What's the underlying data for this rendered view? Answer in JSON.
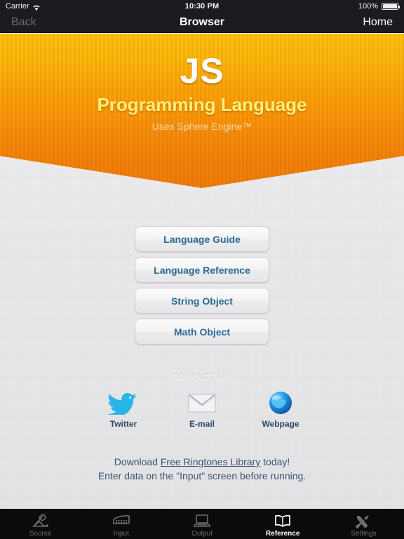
{
  "status_bar": {
    "carrier": "Carrier",
    "wifi_icon": "wifi-icon",
    "time": "10:30 PM",
    "battery_percent": "100%",
    "battery_icon": "battery-icon"
  },
  "nav_bar": {
    "back_label": "Back",
    "title": "Browser",
    "home_label": "Home"
  },
  "banner": {
    "logo": "JS",
    "subtitle": "Programming Language",
    "engine_note": "Uses Sphere Engine™",
    "colors": {
      "top": "#fec10d",
      "bottom": "#f07c08",
      "subtitle_color": "#ffef7a"
    }
  },
  "menu": {
    "buttons": [
      {
        "label": "Language Guide"
      },
      {
        "label": "Language Reference"
      },
      {
        "label": "String Object"
      },
      {
        "label": "Math Object"
      }
    ],
    "text_color": "#2c6b92"
  },
  "contact": {
    "title": "CONTACT US:",
    "items": [
      {
        "label": "Twitter",
        "icon": "twitter-bird-icon"
      },
      {
        "label": "E-mail",
        "icon": "envelope-icon"
      },
      {
        "label": "Webpage",
        "icon": "globe-icon"
      }
    ]
  },
  "footer": {
    "line1_before": "Download ",
    "line1_link": "Free Ringtones Library",
    "line1_after": " today!",
    "line2": "Enter data on the \"Input\" screen before running."
  },
  "tab_bar": {
    "active_index": 3,
    "items": [
      {
        "label": "Source",
        "icon": "pen-writing-icon"
      },
      {
        "label": "Input",
        "icon": "keyboard-icon"
      },
      {
        "label": "Output",
        "icon": "laptop-icon"
      },
      {
        "label": "Reference",
        "icon": "open-book-icon"
      },
      {
        "label": "Settings",
        "icon": "tools-icon"
      }
    ]
  }
}
